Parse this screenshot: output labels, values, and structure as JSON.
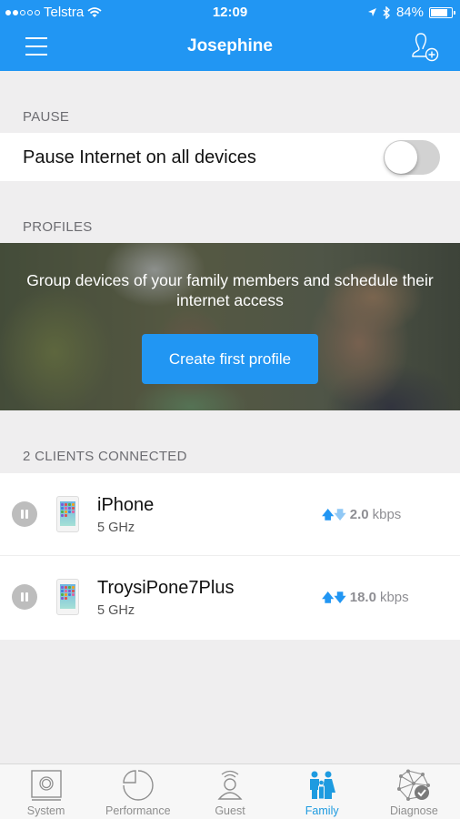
{
  "status_bar": {
    "signal_dots_filled": 2,
    "signal_dots_total": 5,
    "carrier": "Telstra",
    "time": "12:09",
    "battery_percent": "84%",
    "battery_level": 0.84
  },
  "header": {
    "title": "Josephine",
    "menu_icon": "hamburger-icon",
    "add_user_icon": "add-user-icon"
  },
  "pause": {
    "section_label": "PAUSE",
    "row_label": "Pause Internet on all devices",
    "toggle_on": false
  },
  "profiles": {
    "section_label": "PROFILES",
    "description": "Group devices of your family members and schedule their internet access",
    "cta_label": "Create first profile"
  },
  "clients": {
    "section_label": "2 CLIENTS CONNECTED",
    "items": [
      {
        "name": "iPhone",
        "band": "5 GHz",
        "rate_value": "2.0",
        "rate_unit": "kbps",
        "upload_active": true,
        "download_active": false
      },
      {
        "name": "TroysiPone7Plus",
        "band": "5 GHz",
        "rate_value": "18.0",
        "rate_unit": "kbps",
        "upload_active": true,
        "download_active": true
      }
    ]
  },
  "tabbar": {
    "active": "Family",
    "tabs": [
      {
        "label": "System",
        "icon": "system-icon"
      },
      {
        "label": "Performance",
        "icon": "performance-icon"
      },
      {
        "label": "Guest",
        "icon": "guest-icon"
      },
      {
        "label": "Family",
        "icon": "family-icon"
      },
      {
        "label": "Diagnose",
        "icon": "diagnose-icon"
      }
    ]
  },
  "colors": {
    "brand_blue": "#2196f3",
    "active_tab": "#1e9be0",
    "arrow_active": "#2196f3",
    "arrow_inactive": "#90c8f5"
  }
}
